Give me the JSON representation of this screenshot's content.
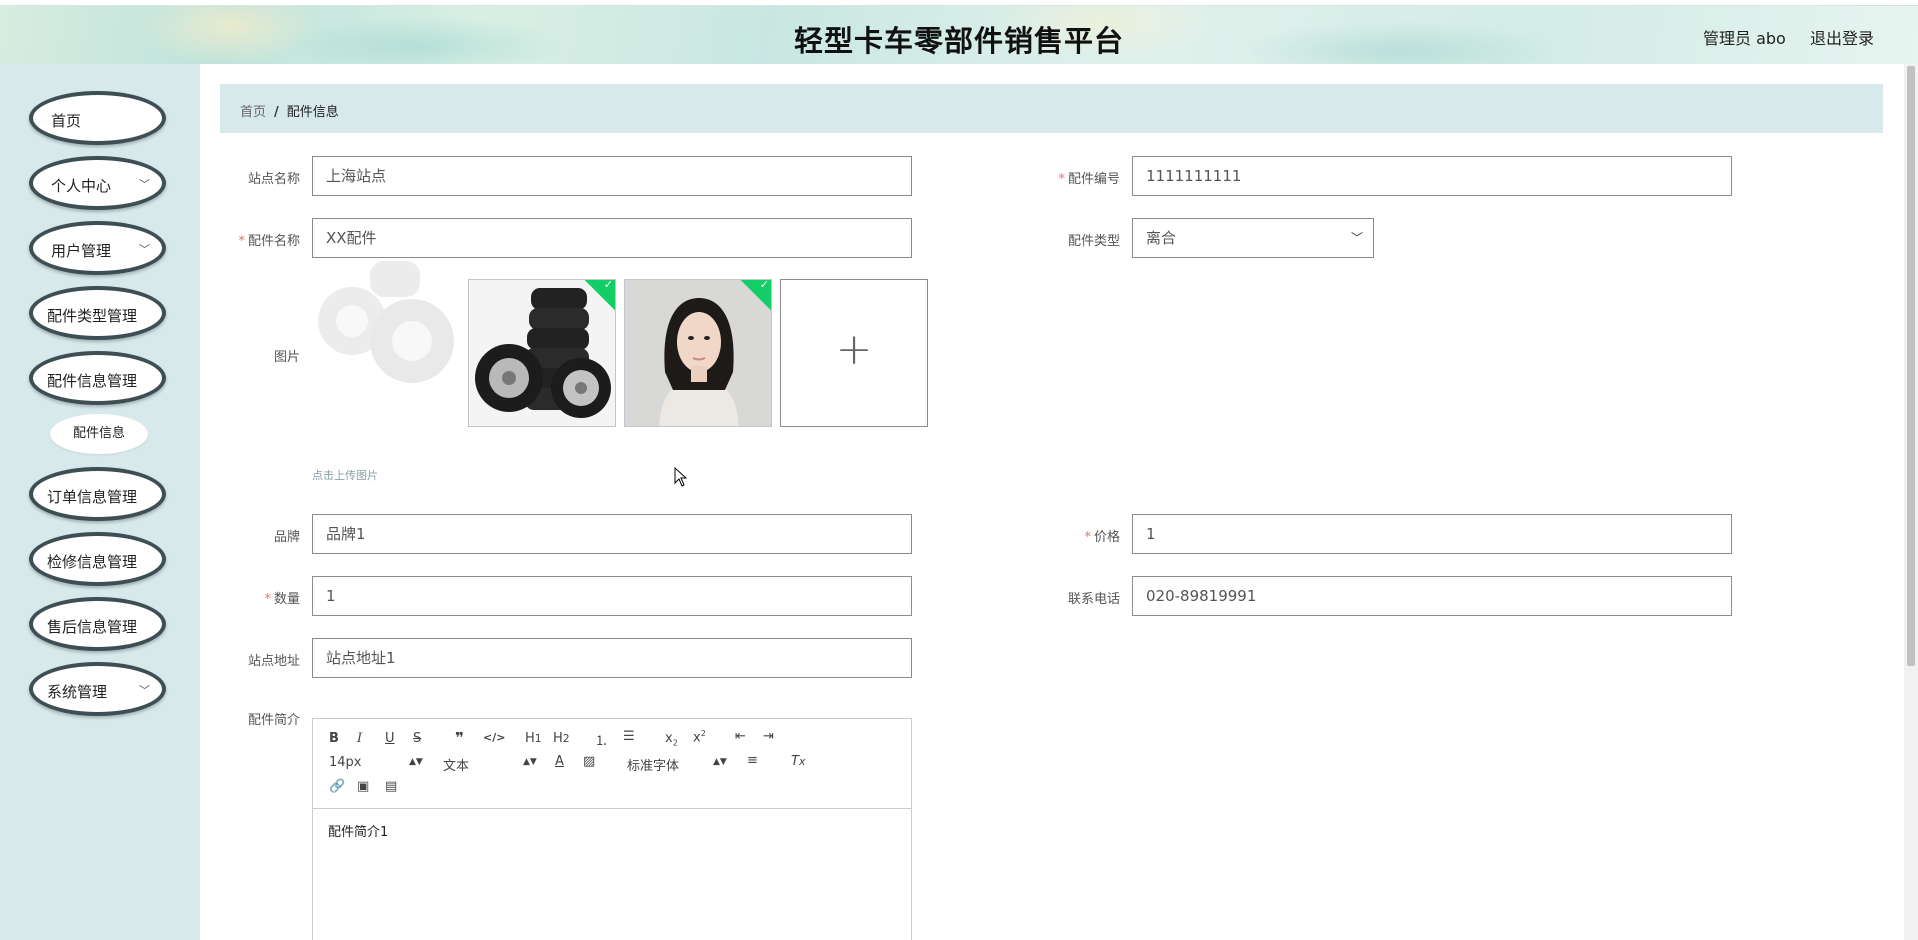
{
  "header": {
    "title": "轻型卡车零部件销售平台",
    "user": "管理员 abo",
    "logout": "退出登录"
  },
  "sidebar": {
    "items": [
      {
        "label": "首页",
        "has_children": false
      },
      {
        "label": "个人中心",
        "has_children": true
      },
      {
        "label": "用户管理",
        "has_children": true
      },
      {
        "label": "配件类型管理",
        "has_children": false
      },
      {
        "label": "配件信息管理",
        "has_children": false
      },
      {
        "label": "订单信息管理",
        "has_children": false
      },
      {
        "label": "检修信息管理",
        "has_children": false
      },
      {
        "label": "售后信息管理",
        "has_children": false
      },
      {
        "label": "系统管理",
        "has_children": true
      }
    ],
    "sub_item": "配件信息"
  },
  "breadcrumb": {
    "home": "首页",
    "separator": "/",
    "current": "配件信息"
  },
  "form": {
    "station_name": {
      "label": "站点名称",
      "value": "上海站点"
    },
    "part_code": {
      "label": "配件编号",
      "value": "1111111111",
      "required": true
    },
    "part_name": {
      "label": "配件名称",
      "value": "XX配件",
      "required": true
    },
    "part_type": {
      "label": "配件类型",
      "value": "离合"
    },
    "image": {
      "label": "图片",
      "upload_tip": "点击上传图片"
    },
    "brand": {
      "label": "品牌",
      "value": "品牌1"
    },
    "price": {
      "label": "价格",
      "value": "1",
      "required": true
    },
    "quantity": {
      "label": "数量",
      "value": "1",
      "required": true
    },
    "phone": {
      "label": "联系电话",
      "value": "020-89819991"
    },
    "station_address": {
      "label": "站点地址",
      "value": "站点地址1"
    },
    "intro": {
      "label": "配件简介",
      "content": "配件简介1"
    }
  },
  "editor_toolbar": {
    "size": "14px",
    "header": "文本",
    "font": "标准字体"
  },
  "colors": {
    "sidebar_bg": "#d8e9ec",
    "menu_border": "#3d4e55",
    "required": "#f56c6c",
    "success": "#13ce66"
  }
}
